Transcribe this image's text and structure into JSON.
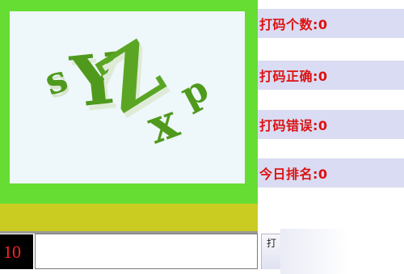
{
  "captcha": {
    "text": "sYZxp"
  },
  "stats": {
    "typed_label": "打码个数:0",
    "correct_label": "打码正确:0",
    "wrong_label": "打码错误:0",
    "rank_label": "今日排名:0"
  },
  "input": {
    "counter": "10",
    "value": ""
  },
  "submit": {
    "label": "打"
  },
  "colors": {
    "frame_green": "#66dd33",
    "bar_yellow": "#cbcc22",
    "stat_text_red": "#dd1111",
    "stat_bg": "#d9dcf2",
    "captcha_green": "#4f9a1c"
  }
}
